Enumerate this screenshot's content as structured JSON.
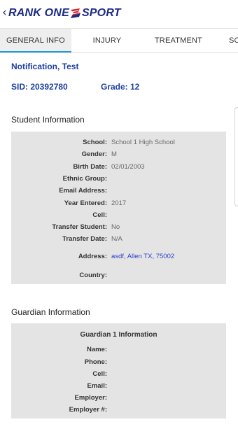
{
  "header": {
    "back_glyph": "‹",
    "logo_part1": "RANK ONE",
    "logo_part2": "SPORT"
  },
  "tabs": [
    {
      "label": "GENERAL INFO",
      "active": true
    },
    {
      "label": "INJURY",
      "active": false
    },
    {
      "label": "TREATMENT",
      "active": false
    },
    {
      "label": "SC",
      "active": false
    }
  ],
  "student": {
    "name": "Notification, Test",
    "sid": "SID: 20392780",
    "grade": "Grade: 12"
  },
  "student_info": {
    "title": "Student Information",
    "fields": [
      {
        "label": "School:",
        "value": "School 1 High School"
      },
      {
        "label": "Gender:",
        "value": "M"
      },
      {
        "label": "Birth Date:",
        "value": "02/01/2003"
      },
      {
        "label": "Ethnic Group:",
        "value": ""
      },
      {
        "label": "Email Address:",
        "value": ""
      },
      {
        "label": "Year Entered:",
        "value": "2017"
      },
      {
        "label": "Cell:",
        "value": ""
      },
      {
        "label": "Transfer Student:",
        "value": "No"
      },
      {
        "label": "Transfer Date:",
        "value": "N/A"
      },
      {
        "label": "Address:",
        "value": "asdf, Allen TX, 75002"
      },
      {
        "label": "Country:",
        "value": ""
      }
    ]
  },
  "guardian_info": {
    "title": "Guardian Information",
    "guardian_title": "Guardian 1 Information",
    "fields": [
      {
        "label": "Name:",
        "value": ""
      },
      {
        "label": "Phone:",
        "value": ""
      },
      {
        "label": "Cell:",
        "value": ""
      },
      {
        "label": "Email:",
        "value": ""
      },
      {
        "label": "Employer:",
        "value": ""
      },
      {
        "label": "Employer #:",
        "value": ""
      }
    ]
  },
  "colors": {
    "brand_blue": "#1c2a84",
    "brand_red": "#d8232a",
    "tab_indicator": "#1f9bd8",
    "link": "#2d3fc9"
  }
}
